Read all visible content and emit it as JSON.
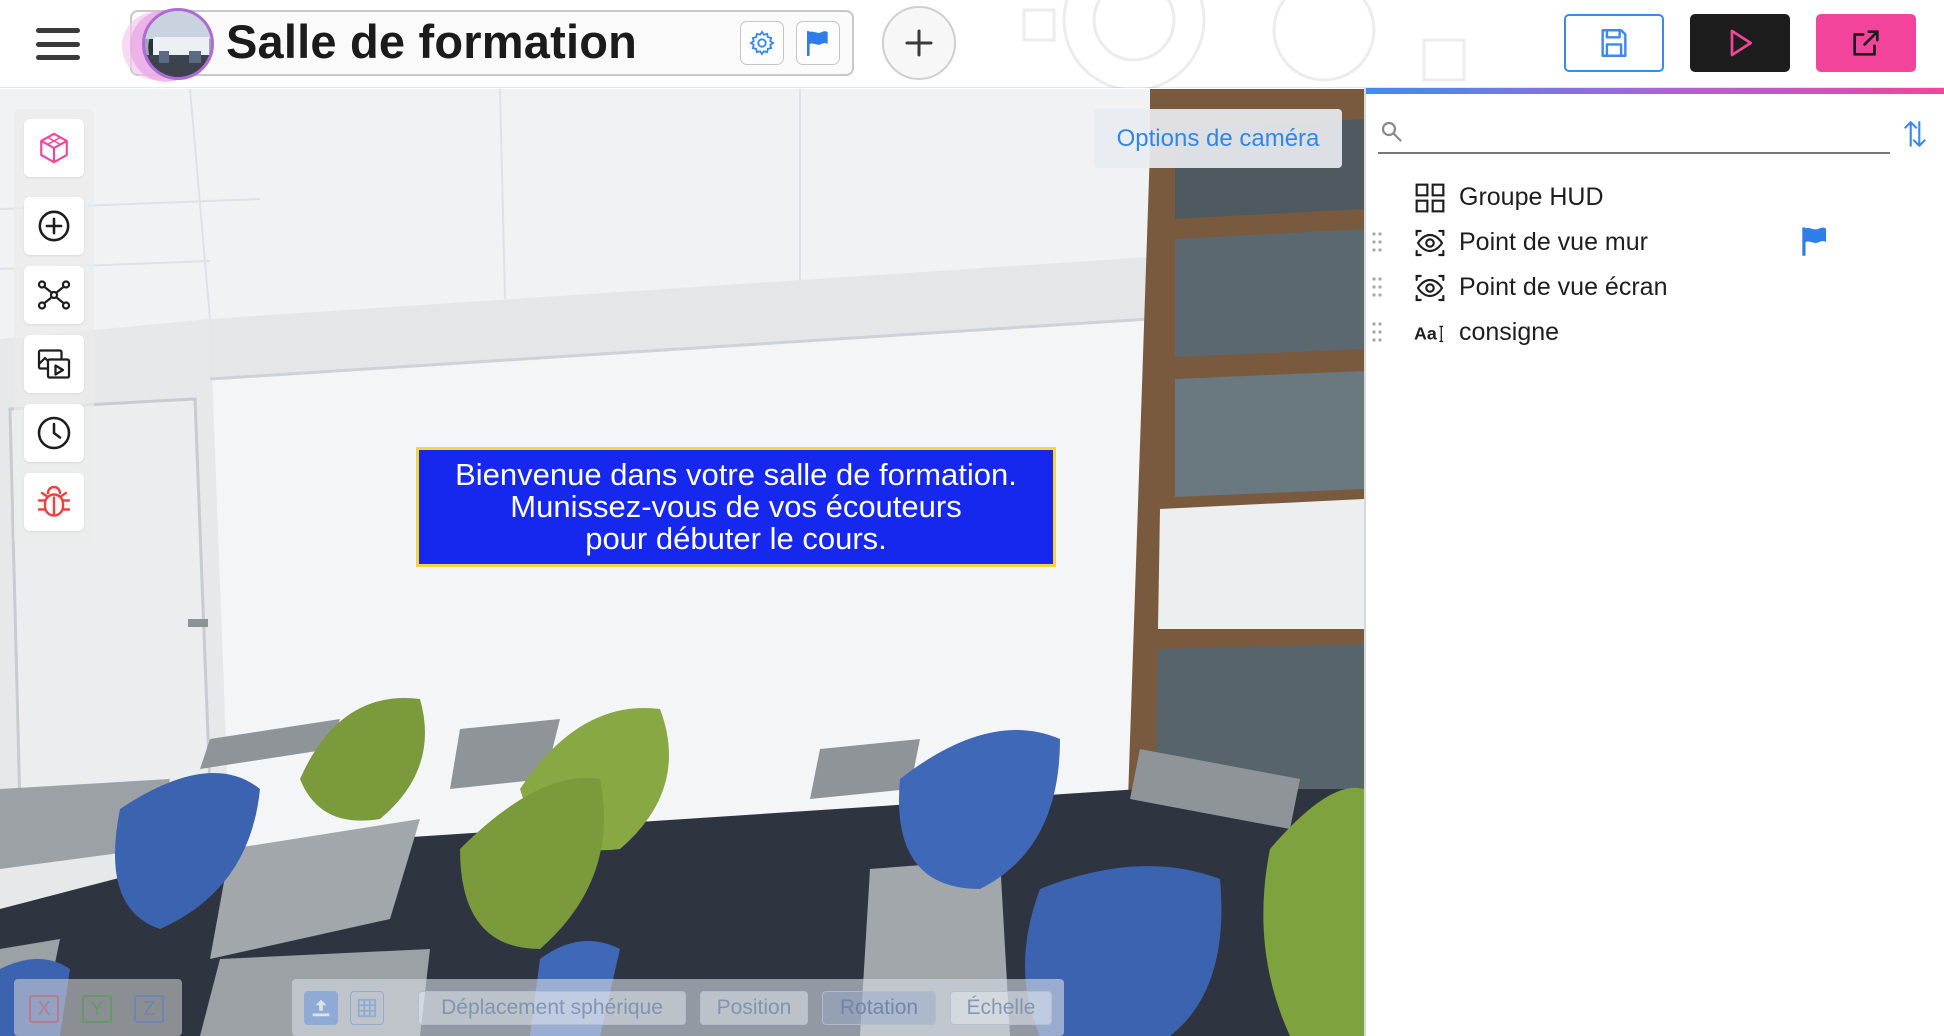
{
  "app": {
    "title": "Salle de formation"
  },
  "topbar": {
    "menu_icon": "hamburger-menu-icon",
    "avatar_icon": "scene-thumbnail",
    "settings_icon": "gear-icon",
    "flag_icon": "flag-icon",
    "add_icon": "plus-icon",
    "save_icon": "floppy-disk-icon",
    "play_icon": "play-icon",
    "export_icon": "external-link-icon"
  },
  "viewport": {
    "camera_options_label": "Options de caméra",
    "hud_lines": [
      "Bienvenue dans votre salle de formation.",
      "Munissez-vous de vos écouteurs",
      "pour débuter le cours."
    ],
    "left_toolbar": [
      {
        "icon": "cube-icon"
      },
      {
        "icon": "add-circle-icon"
      },
      {
        "icon": "graph-nodes-icon"
      },
      {
        "icon": "media-gallery-icon"
      },
      {
        "icon": "clock-icon"
      },
      {
        "icon": "bug-icon"
      }
    ],
    "axes": [
      "X",
      "Y",
      "Z"
    ],
    "transform_modes": {
      "spherical": "Déplacement sphérique",
      "position": "Position",
      "rotation": "Rotation",
      "scale": "Échelle",
      "active": "Rotation"
    }
  },
  "panel": {
    "search": {
      "value": "",
      "placeholder": ""
    },
    "items": [
      {
        "label": "Groupe HUD",
        "icon": "hud-grid-icon",
        "flagged": false
      },
      {
        "label": "Point de vue mur",
        "icon": "viewpoint-eye-icon",
        "flagged": true
      },
      {
        "label": "Point de vue écran",
        "icon": "viewpoint-eye-icon",
        "flagged": false
      },
      {
        "label": "consigne",
        "icon": "text-icon",
        "flagged": false
      }
    ]
  },
  "colors": {
    "accent_blue": "#3b88f0",
    "accent_pink": "#f2449a",
    "hud_bg": "#1628ee",
    "hud_border": "#f2d63a"
  }
}
